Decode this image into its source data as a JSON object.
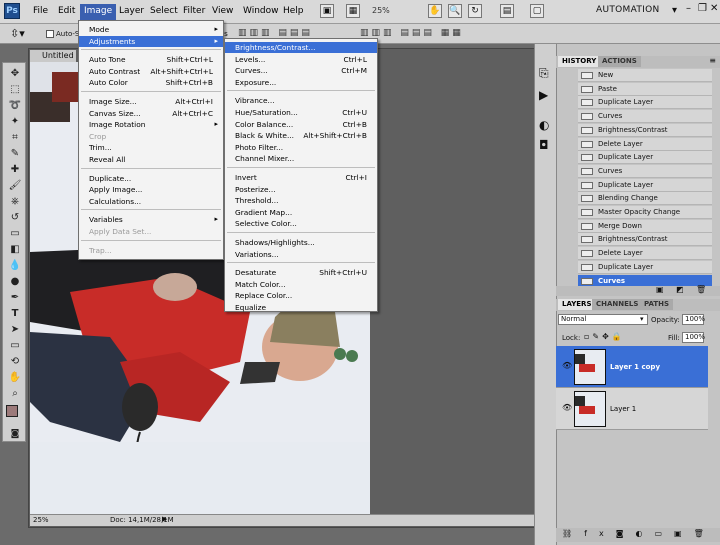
{
  "app": {
    "logo": "Ps",
    "workspace": "AUTOMATION"
  },
  "menubar": [
    "File",
    "Edit",
    "Image",
    "Layer",
    "Select",
    "Filter",
    "View",
    "Window",
    "Help"
  ],
  "menubar_active": "Image",
  "zoom_readout": "25%",
  "optionsbar": {
    "auto_select": "Auto-S",
    "controls": "ntrols"
  },
  "document": {
    "tab_title": "Untitled",
    "status_zoom": "25%",
    "doc_info": "Doc: 14,1M/28,1M"
  },
  "image_menu": {
    "groups": [
      [
        {
          "label": "Mode",
          "sub": true
        },
        {
          "label": "Adjustments",
          "sub": true,
          "highlight": true
        }
      ],
      [
        {
          "label": "Auto Tone",
          "sc": "Shift+Ctrl+L"
        },
        {
          "label": "Auto Contrast",
          "sc": "Alt+Shift+Ctrl+L"
        },
        {
          "label": "Auto Color",
          "sc": "Shift+Ctrl+B"
        }
      ],
      [
        {
          "label": "Image Size...",
          "sc": "Alt+Ctrl+I"
        },
        {
          "label": "Canvas Size...",
          "sc": "Alt+Ctrl+C"
        },
        {
          "label": "Image Rotation",
          "sub": true
        },
        {
          "label": "Crop",
          "disabled": true
        },
        {
          "label": "Trim..."
        },
        {
          "label": "Reveal All"
        }
      ],
      [
        {
          "label": "Duplicate..."
        },
        {
          "label": "Apply Image..."
        },
        {
          "label": "Calculations..."
        }
      ],
      [
        {
          "label": "Variables",
          "sub": true
        },
        {
          "label": "Apply Data Set...",
          "disabled": true
        }
      ],
      [
        {
          "label": "Trap...",
          "disabled": true
        }
      ]
    ]
  },
  "adjustments_menu": {
    "groups": [
      [
        {
          "label": "Brightness/Contrast...",
          "highlight": true
        },
        {
          "label": "Levels...",
          "sc": "Ctrl+L"
        },
        {
          "label": "Curves...",
          "sc": "Ctrl+M"
        },
        {
          "label": "Exposure..."
        }
      ],
      [
        {
          "label": "Vibrance..."
        },
        {
          "label": "Hue/Saturation...",
          "sc": "Ctrl+U"
        },
        {
          "label": "Color Balance...",
          "sc": "Ctrl+B"
        },
        {
          "label": "Black & White...",
          "sc": "Alt+Shift+Ctrl+B"
        },
        {
          "label": "Photo Filter..."
        },
        {
          "label": "Channel Mixer..."
        }
      ],
      [
        {
          "label": "Invert",
          "sc": "Ctrl+I"
        },
        {
          "label": "Posterize..."
        },
        {
          "label": "Threshold..."
        },
        {
          "label": "Gradient Map..."
        },
        {
          "label": "Selective Color..."
        }
      ],
      [
        {
          "label": "Shadows/Highlights..."
        },
        {
          "label": "Variations..."
        }
      ],
      [
        {
          "label": "Desaturate",
          "sc": "Shift+Ctrl+U"
        },
        {
          "label": "Match Color..."
        },
        {
          "label": "Replace Color..."
        },
        {
          "label": "Equalize"
        }
      ]
    ]
  },
  "history_panel": {
    "tabs": [
      "HISTORY",
      "ACTIONS"
    ],
    "items": [
      "New",
      "Paste",
      "Duplicate Layer",
      "Curves",
      "Brightness/Contrast",
      "Delete Layer",
      "Duplicate Layer",
      "Curves",
      "Duplicate Layer",
      "Blending Change",
      "Master Opacity Change",
      "Merge Down",
      "Brightness/Contrast",
      "Delete Layer",
      "Duplicate Layer",
      "Curves"
    ],
    "selected_index": 15
  },
  "layers_panel": {
    "tabs": [
      "LAYERS",
      "CHANNELS",
      "PATHS"
    ],
    "blend_mode": "Normal",
    "opacity_label": "Opacity:",
    "opacity": "100%",
    "lock_label": "Lock:",
    "fill_label": "Fill:",
    "fill": "100%",
    "layers": [
      {
        "name": "Layer 1 copy",
        "selected": true
      },
      {
        "name": "Layer 1",
        "selected": false
      }
    ]
  },
  "colors": {
    "foreground": "#9c7a7a",
    "background": "#ffffff",
    "highlight": "#3a6fd6"
  }
}
